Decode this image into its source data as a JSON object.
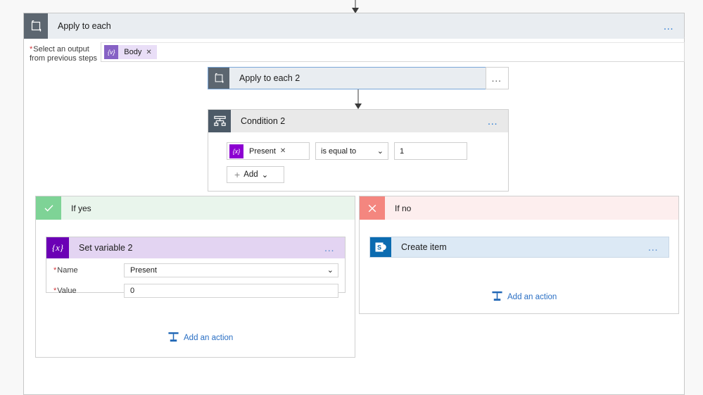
{
  "flow": {
    "outer_loop": {
      "title": "Apply to each",
      "icon": "loop-icon",
      "menu": "…",
      "select_output": {
        "label_line1": "Select an output",
        "label_line2": "from previous steps",
        "required_marker": "*",
        "token": {
          "icon": "dynamic-content-icon",
          "icon_glyph": "{v}",
          "label": "Body",
          "remove": "✕"
        }
      }
    },
    "inner_loop": {
      "title": "Apply to each 2",
      "icon": "loop-icon",
      "menu": "…"
    },
    "condition": {
      "title": "Condition 2",
      "icon": "condition-icon",
      "menu": "…",
      "row": {
        "left_token": {
          "icon": "variable-icon",
          "icon_glyph": "{x}",
          "label": "Present",
          "remove": "✕"
        },
        "operator": "is equal to",
        "operator_chevron": "⌄",
        "value": "1"
      },
      "add_button": {
        "plus": "+",
        "label": "Add",
        "chevron": "⌄"
      }
    },
    "branch_yes": {
      "title": "If yes",
      "icon": "checkmark-icon",
      "icon_glyph": "✓",
      "action": {
        "title": "Set variable 2",
        "icon": "variable-icon",
        "icon_glyph": "{x}",
        "menu": "…",
        "params": [
          {
            "label": "Name",
            "required_marker": "*",
            "value": "Present",
            "type": "dropdown",
            "chevron": "⌄"
          },
          {
            "label": "Value",
            "required_marker": "*",
            "value": "0",
            "type": "text",
            "chevron": ""
          }
        ]
      },
      "add_action": {
        "icon": "add-action-icon",
        "label": "Add an action"
      }
    },
    "branch_no": {
      "title": "If no",
      "icon": "close-icon",
      "icon_glyph": "✕",
      "action": {
        "title": "Create item",
        "icon": "sharepoint-icon",
        "icon_glyph": "S",
        "menu": "…"
      },
      "add_action": {
        "icon": "add-action-icon",
        "label": "Add an action"
      }
    }
  },
  "colors": {
    "loop_header_icon": "#5c6670",
    "loop_header_bg": "#e9edf1",
    "condition_icon": "#4c5a67",
    "variable_purple": "#6b00b5",
    "token_purple": "#8661c5",
    "sharepoint_blue": "#0b6bb0",
    "yes_green": "#7ed396",
    "no_red": "#f4867f",
    "link_blue": "#2a6fc4",
    "required_red": "#d13438"
  }
}
